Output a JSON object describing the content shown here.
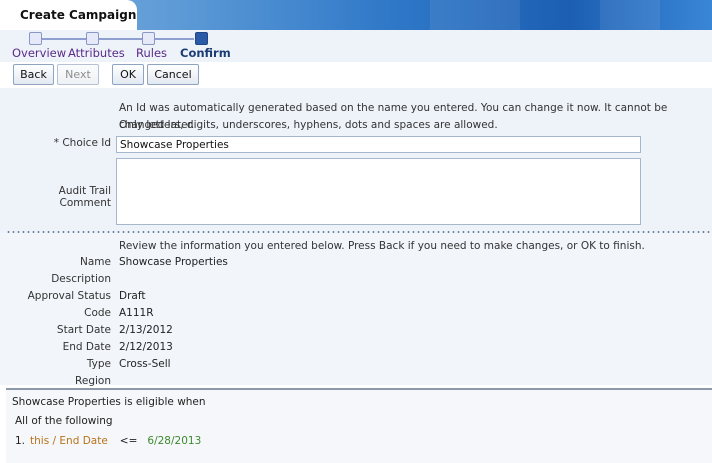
{
  "header": {
    "tab_title": "Create Campaign"
  },
  "train": {
    "steps": [
      {
        "label": "Overview"
      },
      {
        "label": "Attributes"
      },
      {
        "label": "Rules"
      },
      {
        "label": "Confirm"
      }
    ]
  },
  "toolbar": {
    "back_label": "Back",
    "next_label": "Next",
    "ok_label": "OK",
    "cancel_label": "Cancel"
  },
  "id_section": {
    "info_line1": "An Id was automatically generated based on the name you entered. You can change it now. It cannot be changed later.",
    "info_line2": "Only letters, digits, underscores, hyphens, dots and spaces are allowed.",
    "choice_id_label": "* Choice Id",
    "choice_id_value": "Showcase Properties",
    "audit_label": "Audit Trail Comment",
    "audit_value": ""
  },
  "review": {
    "instructions": "Review the information you entered below. Press Back if you need to make changes, or OK to finish.",
    "fields": [
      {
        "label": "Name",
        "value": "Showcase Properties"
      },
      {
        "label": "Description",
        "value": ""
      },
      {
        "label": "Approval Status",
        "value": "Draft"
      },
      {
        "label": "Code",
        "value": "A111R"
      },
      {
        "label": "Start Date",
        "value": "2/13/2012"
      },
      {
        "label": "End Date",
        "value": "2/12/2013"
      },
      {
        "label": "Type",
        "value": "Cross-Sell"
      },
      {
        "label": "Region",
        "value": ""
      }
    ]
  },
  "eligibility": {
    "title": "Showcase Properties is eligible when",
    "group_label": "All of the following",
    "rules": [
      {
        "number": "1.",
        "attribute": "this / End Date",
        "operator": "<=",
        "value": "6/28/2013"
      }
    ]
  },
  "colors": {
    "train_current": "#2b5aa6",
    "rule_attribute": "#b8731a",
    "rule_value": "#3e8a2e"
  }
}
